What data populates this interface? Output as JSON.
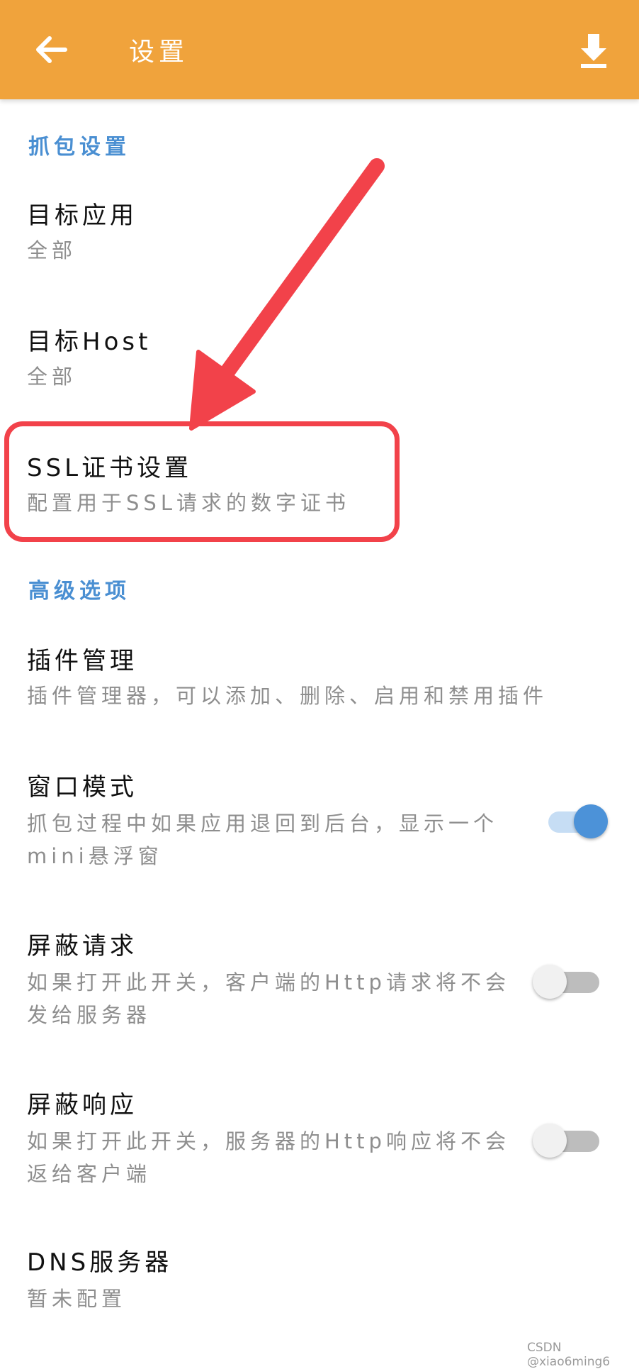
{
  "appbar": {
    "title": "设置",
    "back_icon": "arrow-back-icon",
    "download_icon": "download-icon",
    "color": "#F0A33C"
  },
  "sections": [
    {
      "header": "抓包设置",
      "items": [
        {
          "title": "目标应用",
          "summary": "全部"
        },
        {
          "title": "目标Host",
          "summary": "全部"
        },
        {
          "title": "SSL证书设置",
          "summary": "配置用于SSL请求的数字证书"
        }
      ]
    },
    {
      "header": "高级选项",
      "items": [
        {
          "title": "插件管理",
          "summary": "插件管理器，可以添加、删除、启用和禁用插件"
        },
        {
          "title": "窗口模式",
          "summary_line1": "抓包过程中如果应用退回到后台，显示一个",
          "summary_line2": "mini悬浮窗",
          "switch_on": true
        },
        {
          "title": "屏蔽请求",
          "summary_line1": "如果打开此开关，客户端的Http请求将不会",
          "summary_line2": "发给服务器",
          "switch_on": false
        },
        {
          "title": "屏蔽响应",
          "summary_line1": "如果打开此开关，服务器的Http响应将不会",
          "summary_line2": "返给客户端",
          "switch_on": false
        },
        {
          "title": "DNS服务器",
          "summary": "暂未配置"
        }
      ]
    }
  ],
  "annotation": {
    "color": "#F2424A"
  },
  "watermark": "CSDN @xiao6ming6"
}
